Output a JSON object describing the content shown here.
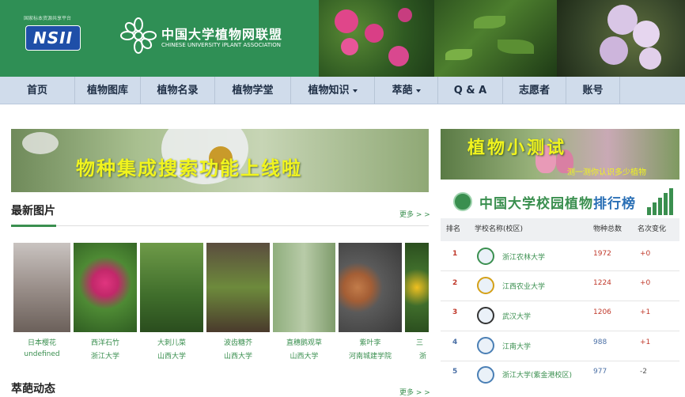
{
  "header": {
    "nsii_small": "国家标本资源共享平台",
    "nsii_logo": "NSII",
    "title_cn": "中国大学植物网联盟",
    "title_en": "CHINESE UNIVERSITY iPLANT ASSOCIATION",
    "brand_green": "#2f8f55"
  },
  "nav": {
    "items": [
      {
        "label": "首页"
      },
      {
        "label": "植物图库"
      },
      {
        "label": "植物名录"
      },
      {
        "label": "植物学堂"
      },
      {
        "label": "植物知识"
      },
      {
        "label": "萃葩"
      },
      {
        "label": "Q & A"
      },
      {
        "label": "志愿者"
      },
      {
        "label": "账号"
      }
    ]
  },
  "banner": {
    "text": "物种集成搜索功能上线啦"
  },
  "latest": {
    "title": "最新图片",
    "more": "更多 > >",
    "items": [
      {
        "name": "日本樱花",
        "school": "undefined"
      },
      {
        "name": "西洋石竹",
        "school": "浙江大学"
      },
      {
        "name": "大刺儿菜",
        "school": "山西大学"
      },
      {
        "name": "波齿糖芥",
        "school": "山西大学"
      },
      {
        "name": "直穗鹅观草",
        "school": "山西大学"
      },
      {
        "name": "紫叶李",
        "school": "河南城建学院"
      },
      {
        "name": "三",
        "school": "浙"
      }
    ]
  },
  "news": {
    "title": "萃葩动态",
    "more": "更多 > >"
  },
  "quiz": {
    "title": "植物小测试",
    "subtitle": "测一测你认识多少植物"
  },
  "ranking": {
    "title_plain": "中国大学校园植物",
    "title_accent": "排行榜",
    "headers": {
      "rank": "排名",
      "school": "学校名称(校区)",
      "count": "物种总数",
      "change": "名次变化"
    },
    "rows": [
      {
        "rank": "1",
        "school": "浙江农林大学",
        "count": "1972",
        "change": "+0"
      },
      {
        "rank": "2",
        "school": "江西农业大学",
        "count": "1224",
        "change": "+0"
      },
      {
        "rank": "3",
        "school": "武汉大学",
        "count": "1206",
        "change": "+1"
      },
      {
        "rank": "4",
        "school": "江南大学",
        "count": "988",
        "change": "+1"
      },
      {
        "rank": "5",
        "school": "浙江大学(紫金港校区)",
        "count": "977",
        "change": "-2"
      }
    ]
  }
}
